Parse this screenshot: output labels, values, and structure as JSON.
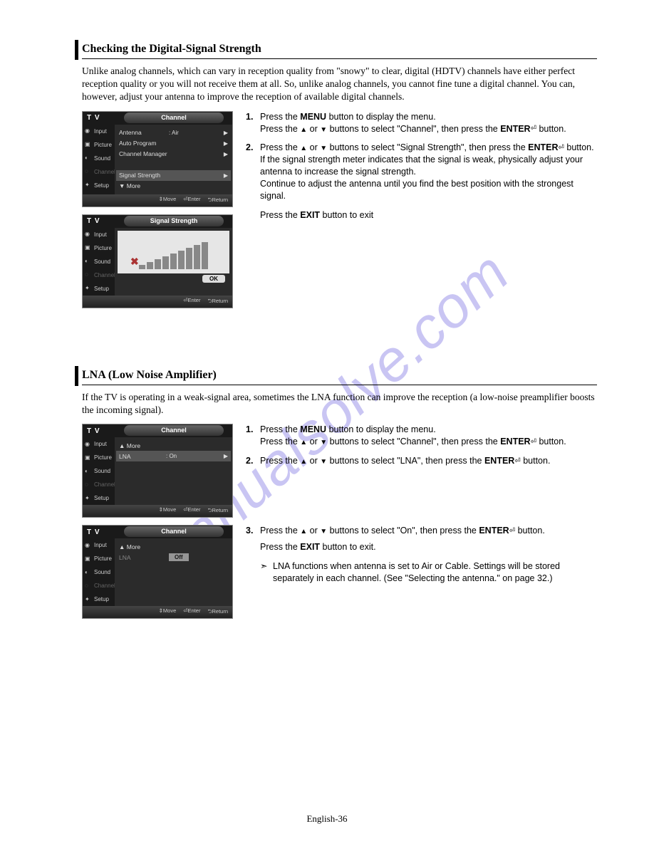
{
  "watermark": "manualsolve.com",
  "page_footer": "English-36",
  "section1": {
    "heading": "Checking the Digital-Signal Strength",
    "intro": "Unlike analog channels, which can vary in reception quality from \"snowy\" to clear, digital (HDTV) channels have either perfect reception quality or you will not receive them at all. So, unlike analog channels, you cannot fine tune a digital channel. You can, however, adjust your antenna to improve the reception of available digital channels.",
    "steps": [
      {
        "num": "1.",
        "body_pre": "Press the ",
        "bold1": "MENU",
        "mid1": " button to display the menu.\nPress the ",
        "tri1": "▲",
        "or": " or ",
        "tri2": "▼",
        "mid2": " buttons to select \"Channel\", then press the ",
        "bold2": "ENTER",
        "tail": " button."
      },
      {
        "num": "2.",
        "body_pre": "Press the ",
        "tri1": "▲",
        "or": " or ",
        "tri2": "▼",
        "mid1": " buttons to select \"Signal Strength\", then press the ",
        "bold1": "ENTER",
        "mid2": " button.\nIf the signal strength meter indicates that the signal is weak, physically adjust your antenna to increase the signal strength.\nContinue to adjust the antenna until you find the best position with the strongest signal."
      }
    ],
    "exit_pre": "Press the ",
    "exit_bold": "EXIT",
    "exit_post": " button to exit",
    "osd1": {
      "tv": "T V",
      "title": "Channel",
      "side": [
        "Input",
        "Picture",
        "Sound",
        "Channel",
        "Setup"
      ],
      "rows": [
        {
          "label": "Antenna",
          "val": ": Air",
          "arr": "▶"
        },
        {
          "label": "Auto Program",
          "val": "",
          "arr": "▶"
        },
        {
          "label": "Channel Manager",
          "val": "",
          "arr": "▶"
        },
        {
          "label": "",
          "val": "",
          "arr": ""
        },
        {
          "label": "Signal Strength",
          "val": "",
          "arr": "▶",
          "hl": true
        },
        {
          "label": "▼ More",
          "val": "",
          "arr": ""
        }
      ],
      "footer": [
        "⇕Move",
        "⏎Enter",
        "⮌Return"
      ]
    },
    "osd2": {
      "tv": "T V",
      "title": "Signal Strength",
      "side": [
        "Input",
        "Picture",
        "Sound",
        "Channel",
        "Setup"
      ],
      "ok": "OK",
      "footer": [
        "⏎Enter",
        "⮌Return"
      ]
    }
  },
  "section2": {
    "heading": "LNA (Low Noise Amplifier)",
    "intro": "If the TV is operating in a weak-signal area, sometimes the LNA function can improve the reception (a low-noise preamplifier boosts the incoming signal).",
    "steps_a": [
      {
        "num": "1.",
        "pre": "Press the ",
        "bold1": "MENU",
        "mid1": " button to display the menu.\nPress the ",
        "tri1": "▲",
        "or": " or ",
        "tri2": "▼",
        "mid2": " buttons to select \"Channel\", then press the ",
        "bold2": "ENTER",
        "tail": " button."
      },
      {
        "num": "2.",
        "pre": "Press the ",
        "tri1": "▲",
        "or": " or ",
        "tri2": "▼",
        "mid1": " buttons to select \"LNA\", then press the ",
        "bold1": "ENTER",
        "tail": " button."
      }
    ],
    "steps_b": [
      {
        "num": "3.",
        "pre": "Press the ",
        "tri1": "▲",
        "or": " or ",
        "tri2": "▼",
        "mid1": " buttons to select \"On\", then press the ",
        "bold1": "ENTER",
        "tail": " button."
      }
    ],
    "exit_pre": "Press the ",
    "exit_bold": "EXIT",
    "exit_post": " button to exit.",
    "note": "LNA functions when antenna is set to Air or Cable. Settings will be stored separately in each channel. (See \"Selecting the antenna.\" on page 32.)",
    "osd3": {
      "tv": "T V",
      "title": "Channel",
      "side": [
        "Input",
        "Picture",
        "Sound",
        "Channel",
        "Setup"
      ],
      "rows": [
        {
          "label": "▲ More",
          "val": "",
          "arr": ""
        },
        {
          "label": "LNA",
          "val": ": On",
          "arr": "▶",
          "hl": true
        }
      ],
      "footer": [
        "⇕Move",
        "⏎Enter",
        "⮌Return"
      ]
    },
    "osd4": {
      "tv": "T V",
      "title": "Channel",
      "side": [
        "Input",
        "Picture",
        "Sound",
        "Channel",
        "Setup"
      ],
      "rows": [
        {
          "label": "▲ More",
          "val": "",
          "arr": ""
        },
        {
          "label": "LNA",
          "val": "",
          "sel": "Off",
          "hl": false
        }
      ],
      "footer": [
        "⇕Move",
        "⏎Enter",
        "⮌Return"
      ]
    }
  }
}
